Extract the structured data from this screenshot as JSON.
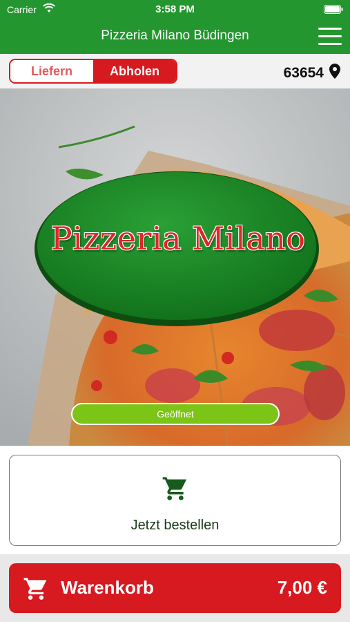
{
  "status": {
    "carrier": "Carrier",
    "time": "3:58 PM",
    "icons": [
      "wifi-icon",
      "battery-icon"
    ]
  },
  "header": {
    "title": "Pizzeria Milano Büdingen",
    "menu_icon": "hamburger-menu-icon"
  },
  "mode_toggle": {
    "options": [
      "Liefern",
      "Abholen"
    ],
    "selected": "Abholen"
  },
  "location": {
    "zip": "63654",
    "icon": "location-pin-icon"
  },
  "hero": {
    "logo_text": "Pizzeria Milano",
    "status_badge": "Geöffnet"
  },
  "order": {
    "label": "Jetzt bestellen",
    "icon": "shopping-cart-icon"
  },
  "cart": {
    "label": "Warenkorb",
    "total": "7,00 €",
    "icon": "shopping-cart-icon"
  },
  "colors": {
    "brand_green": "#24962f",
    "accent_red": "#d71920",
    "open_green": "#7cc416"
  }
}
